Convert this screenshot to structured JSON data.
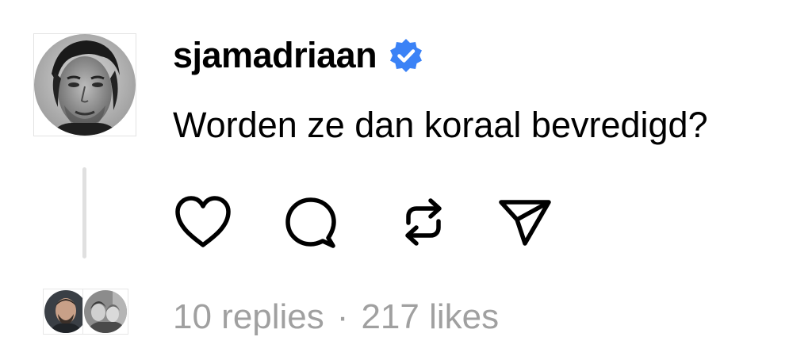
{
  "post": {
    "username": "sjamadriaan",
    "verified": true,
    "text": "Worden ze dan koraal bevredigd?"
  },
  "actions": [
    {
      "icon": "heart-icon"
    },
    {
      "icon": "comment-icon"
    },
    {
      "icon": "repost-icon"
    },
    {
      "icon": "share-icon"
    }
  ],
  "stats": {
    "replies": "10 replies",
    "separator": "·",
    "likes": "217 likes"
  },
  "colors": {
    "verified_badge": "#3b82f6",
    "thread_line": "#e0e0e0",
    "muted_text": "#a0a0a0"
  }
}
